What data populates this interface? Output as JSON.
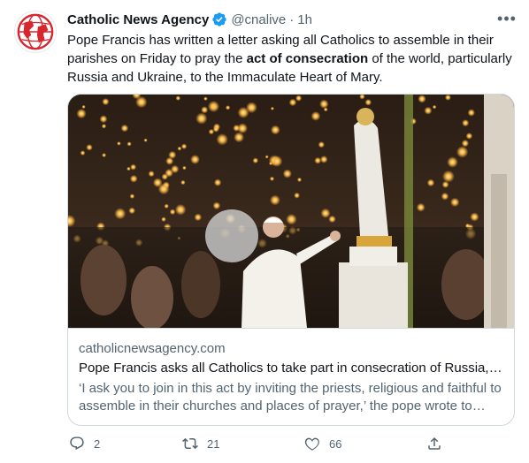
{
  "author": {
    "name": "Catholic News Agency",
    "handle": "@cnalive",
    "separator": "·",
    "time": "1h",
    "avatar_icon": "cna-globe-logo",
    "verified_icon": "verified-badge-icon"
  },
  "tweet": {
    "text_before": "Pope Francis has written a letter asking all Catholics to assemble in their parishes on Friday to pray the ",
    "text_bold": "act of consecration",
    "text_after": " of the world, particularly Russia and Ukraine, to the Immaculate Heart of Mary."
  },
  "card": {
    "image_description_icon": "photo",
    "domain": "catholicnewsagency.com",
    "title": "Pope Francis asks all Catholics to take part in consecration of Russia, …",
    "description": "‘I ask you to join in this act by inviting the priests, religious and faithful to assemble in their churches and places of prayer,’ the pope wrote to…"
  },
  "actions": {
    "reply_count": "2",
    "retweet_count": "21",
    "like_count": "66"
  },
  "colors": {
    "accent": "#1d9bf0",
    "secondary_text": "#536471",
    "border": "#cfd9de",
    "logo_red": "#d7262e"
  }
}
